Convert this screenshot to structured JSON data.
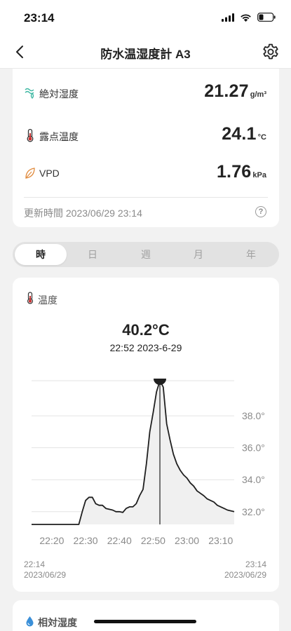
{
  "status": {
    "time": "23:14"
  },
  "nav": {
    "title": "防水温湿度計 A3",
    "back_icon": "chevron-left-icon",
    "settings_icon": "gear-icon"
  },
  "metrics": [
    {
      "label": "絶対湿度",
      "value": "21.27",
      "unit": "g/m³",
      "icon": "absolute-humidity-icon"
    },
    {
      "label": "露点温度",
      "value": "24.1",
      "unit": "°C",
      "icon": "thermometer-icon"
    },
    {
      "label": "VPD",
      "value": "1.76",
      "unit": "kPa",
      "icon": "leaf-icon"
    }
  ],
  "updated": {
    "text": "更新時間 2023/06/29 23:14",
    "help": "?"
  },
  "segments": {
    "items": [
      "時",
      "日",
      "週",
      "月",
      "年"
    ],
    "active": "時"
  },
  "chart_card": {
    "title": "温度",
    "selected_value": "40.2°C",
    "selected_datetime": "22:52 2023-6-29",
    "range_start_time": "22:14",
    "range_start_date": "2023/06/29",
    "range_end_time": "23:14",
    "range_end_date": "2023/06/29"
  },
  "chart_data": {
    "type": "area",
    "x_tick_labels": [
      "22:20",
      "22:30",
      "22:40",
      "22:50",
      "23:00",
      "23:10"
    ],
    "y_tick_labels": [
      "32.0°",
      "34.0°",
      "36.0°",
      "38.0°"
    ],
    "ylim": [
      31.2,
      40.2
    ],
    "xlim_minutes": [
      22.14,
      23.14
    ],
    "grid": true,
    "series": [
      {
        "points": [
          [
            22.14,
            31.2
          ],
          [
            22.2,
            31.2
          ],
          [
            22.24,
            31.2
          ],
          [
            22.28,
            31.2
          ],
          [
            22.29,
            32.0
          ],
          [
            22.3,
            32.7
          ],
          [
            22.31,
            32.9
          ],
          [
            22.32,
            32.9
          ],
          [
            22.33,
            32.5
          ],
          [
            22.34,
            32.4
          ],
          [
            22.35,
            32.4
          ],
          [
            22.36,
            32.2
          ],
          [
            22.38,
            32.1
          ],
          [
            22.39,
            32.0
          ],
          [
            22.4,
            32.0
          ],
          [
            22.41,
            31.95
          ],
          [
            22.42,
            32.2
          ],
          [
            22.43,
            32.3
          ],
          [
            22.44,
            32.3
          ],
          [
            22.45,
            32.5
          ],
          [
            22.46,
            33.0
          ],
          [
            22.47,
            33.4
          ],
          [
            22.48,
            35.0
          ],
          [
            22.49,
            37.0
          ],
          [
            22.5,
            38.2
          ],
          [
            22.51,
            39.5
          ],
          [
            22.52,
            40.2
          ],
          [
            22.53,
            39.8
          ],
          [
            22.54,
            37.5
          ],
          [
            22.55,
            36.5
          ],
          [
            22.56,
            35.6
          ],
          [
            22.57,
            35.0
          ],
          [
            22.58,
            34.6
          ],
          [
            22.59,
            34.3
          ],
          [
            23.0,
            34.1
          ],
          [
            23.01,
            33.8
          ],
          [
            23.02,
            33.6
          ],
          [
            23.03,
            33.3
          ],
          [
            23.05,
            33.0
          ],
          [
            23.06,
            32.8
          ],
          [
            23.07,
            32.7
          ],
          [
            23.08,
            32.6
          ],
          [
            23.09,
            32.4
          ],
          [
            23.1,
            32.3
          ],
          [
            23.11,
            32.2
          ],
          [
            23.12,
            32.1
          ],
          [
            23.14,
            32.0
          ]
        ]
      }
    ],
    "selected_point": [
      22.52,
      40.2
    ]
  },
  "bottom_card": {
    "title": "相対湿度",
    "icon": "water-drop-icon"
  },
  "colors": {
    "accent_dark": "#1f1f1f",
    "icon_green": "#3fb8a3",
    "icon_orange": "#e08a3c",
    "icon_red": "#c93030",
    "drop_blue": "#3a8fd8"
  }
}
